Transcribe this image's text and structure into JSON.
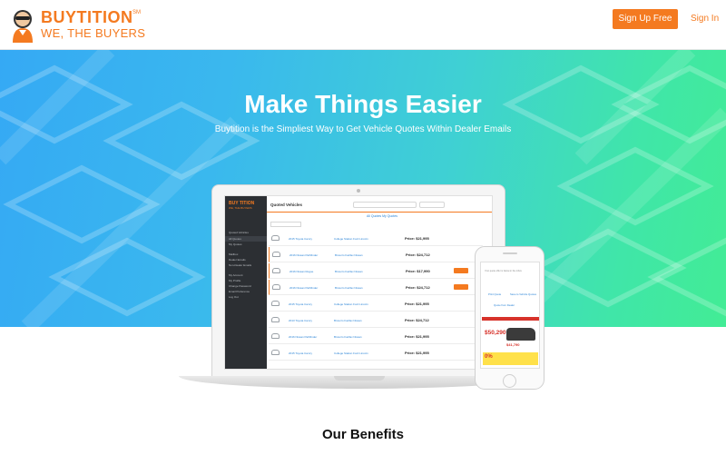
{
  "header": {
    "logo": {
      "brand": "BUYTITION",
      "trademark": "SM",
      "tagline": "WE, THE BUYERS"
    },
    "signup_label": "Sign Up Free",
    "signin_label": "Sign In"
  },
  "hero": {
    "title": "Make Things Easier",
    "subtitle": "Buytition is the Simpliest Way to Get Vehicle Quotes Within Dealer Emails"
  },
  "laptop_app": {
    "brand": "BUY TITION",
    "brand_sub": "WE, THE BUYERS",
    "title": "Quoted Vehicles",
    "tabs": "All Quotes      My Quotes",
    "sidebar": [
      "Quoted Vehicles",
      "All Quotes",
      "My Quotes",
      "Mailbox",
      "Dealer Emails",
      "Non-Dealer Emails",
      "My Account",
      "My Profile",
      "Change Password",
      "Email Preference",
      "Log Out"
    ],
    "rows": [
      {
        "vehicle": "2015 Toyota Camry",
        "dealer": "College Station Ford Lincoln",
        "price": "Price: $21,995"
      },
      {
        "vehicle": "2016 Nissan Pathfinder",
        "dealer": "Brown's Fairfax Nissan",
        "price": "Price: $24,712"
      },
      {
        "vehicle": "2016 Nissan Rogue",
        "dealer": "Brown's Fairfax Nissan",
        "price": "Price: $17,990"
      },
      {
        "vehicle": "2016 Nissan Pathfinder",
        "dealer": "Brown's Fairfax Nissan",
        "price": "Price: $24,712"
      },
      {
        "vehicle": "2015 Toyota Camry",
        "dealer": "College Station Ford Lincoln",
        "price": "Price: $21,995"
      },
      {
        "vehicle": "2013 Toyota Camry",
        "dealer": "Brown's Fairfax Nissan",
        "price": "Price: $24,712"
      },
      {
        "vehicle": "2016 Nissan Pathfinder",
        "dealer": "Brown's Fairfax Nissan",
        "price": "Price: $21,995"
      },
      {
        "vehicle": "2015 Toyota Camry",
        "dealer": "College Station Ford Lincoln",
        "price": "Price: $21,995"
      }
    ]
  },
  "phone_app": {
    "heading": "Your quote offer is below in the inbox",
    "links": [
      "Print Quote",
      "Save to Vehicle Quotes"
    ],
    "ad_link": "Quote from Dealer",
    "ad_price": "$50,290",
    "ad_price2": "$41,790",
    "ad_zero": "0%"
  },
  "benefits": {
    "title": "Our Benefits"
  },
  "colors": {
    "accent": "#f47a20",
    "hero_start": "#35a9f4",
    "hero_end": "#42ec95",
    "link": "#2a83d6"
  }
}
